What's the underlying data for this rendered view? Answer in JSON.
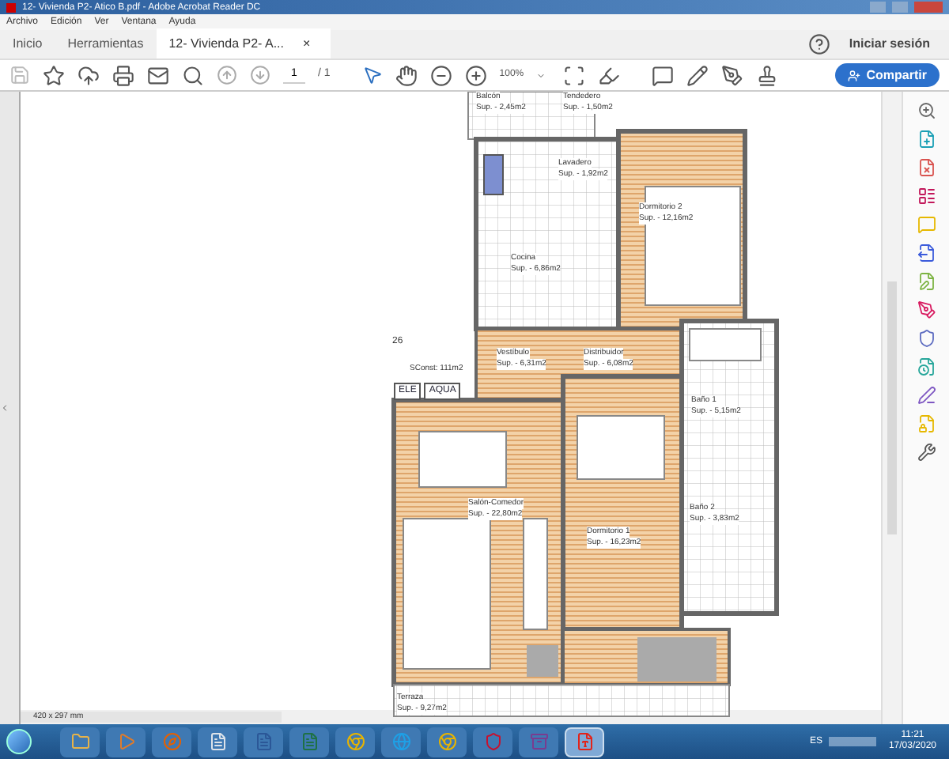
{
  "window": {
    "title": "12- Vivienda P2- Atico B.pdf - Adobe Acrobat Reader DC"
  },
  "menu": [
    "Archivo",
    "Edición",
    "Ver",
    "Ventana",
    "Ayuda"
  ],
  "tabs": [
    {
      "label": "Inicio",
      "selected": false
    },
    {
      "label": "Herramientas",
      "selected": false
    },
    {
      "label": "12- Vivienda P2- A...",
      "selected": true,
      "close": "×"
    }
  ],
  "header": {
    "sign_in": "Iniciar sesión"
  },
  "toolbar": {
    "page": "1",
    "page_total": "/ 1",
    "zoom": "100%",
    "share": "Compartir"
  },
  "document": {
    "rooms": [
      {
        "name": "Balcón",
        "area": "Sup. - 2,45m2"
      },
      {
        "name": "Tendedero",
        "area": "Sup. - 1,50m2"
      },
      {
        "name": "Lavadero",
        "area": "Sup. - 1,92m2"
      },
      {
        "name": "Dormitorio 2",
        "area": "Sup. - 12,16m2"
      },
      {
        "name": "Cocina",
        "area": "Sup. - 6,86m2"
      },
      {
        "name": "Vestíbulo",
        "area": "Sup. - 6,31m2"
      },
      {
        "name": "Distribuidor",
        "area": "Sup. - 6,08m2"
      },
      {
        "name": "Baño 1",
        "area": "Sup. - 5,15m2"
      },
      {
        "name": "Salón-Comedor",
        "area": "Sup. - 22,80m2"
      },
      {
        "name": "Dormitorio 1",
        "area": "Sup. - 16,23m2"
      },
      {
        "name": "Baño 2",
        "area": "Sup. - 3,83m2"
      },
      {
        "name": "Terraza",
        "area": "Sup. - 9,27m2"
      }
    ],
    "unit_number": "26",
    "built_area": "SConst: 111m2",
    "meters": [
      "ELE",
      "AQUA"
    ],
    "page_size": "420 x 297 mm"
  },
  "taskbar": {
    "apps": [
      {
        "kind": "folder",
        "selected": false
      },
      {
        "kind": "media",
        "selected": false
      },
      {
        "kind": "firefox",
        "selected": false
      },
      {
        "kind": "doc",
        "selected": false
      },
      {
        "kind": "word",
        "selected": false
      },
      {
        "kind": "excel",
        "selected": false
      },
      {
        "kind": "chrome",
        "selected": false
      },
      {
        "kind": "ie",
        "selected": false
      },
      {
        "kind": "chrome",
        "selected": false
      },
      {
        "kind": "shield",
        "selected": false
      },
      {
        "kind": "archive",
        "selected": false
      },
      {
        "kind": "acrobat",
        "selected": true
      }
    ],
    "language": "ES",
    "time": "11:21",
    "date": "17/03/2020"
  }
}
